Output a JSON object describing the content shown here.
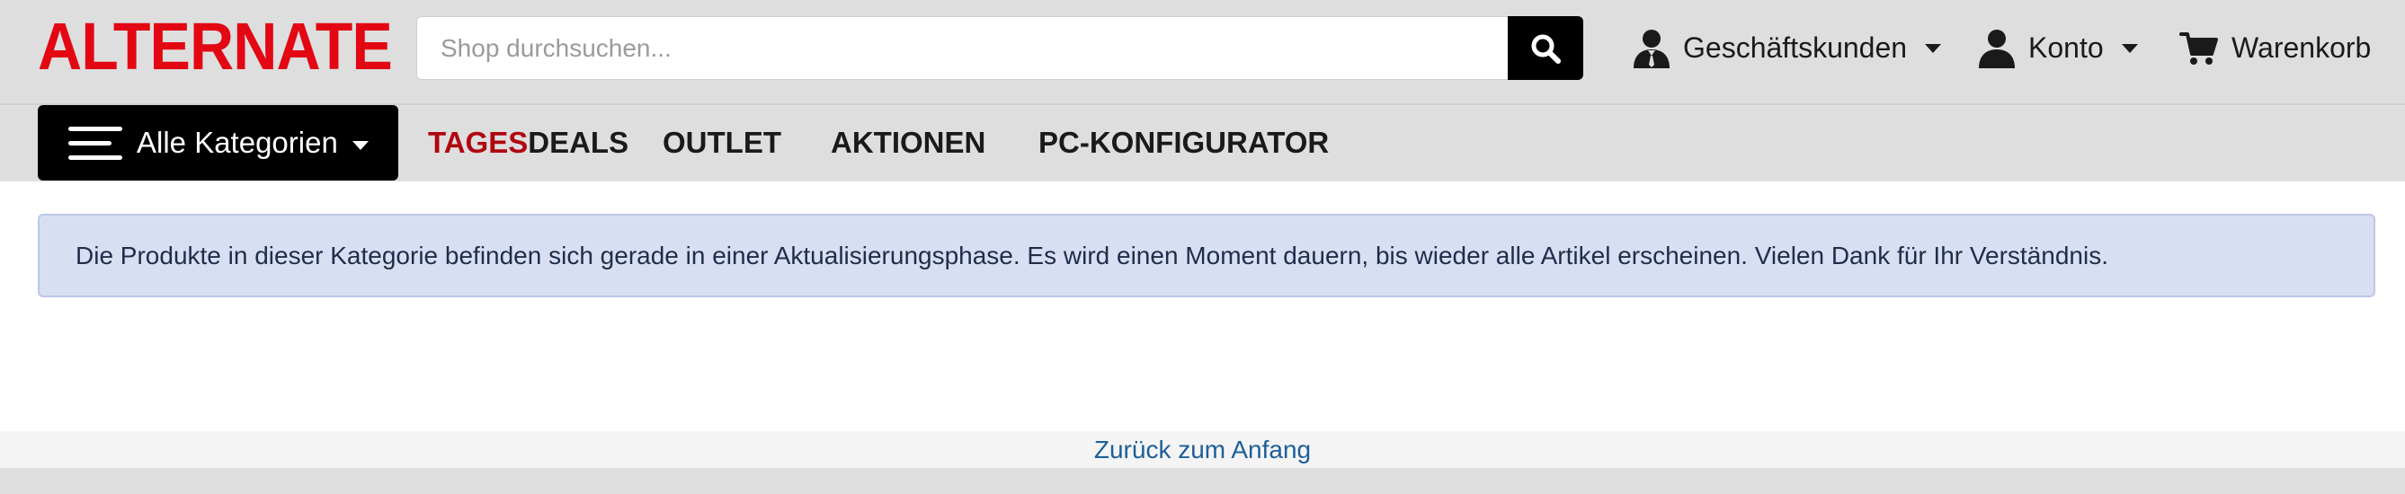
{
  "brand": {
    "logo_text": "ALTERNATE",
    "logo_color": "#e30613"
  },
  "header": {
    "search": {
      "placeholder": "Shop durchsuchen...",
      "value": ""
    },
    "business_label": "Geschäftskunden",
    "account_label": "Konto",
    "cart_label": "Warenkorb",
    "icons": [
      "search-icon",
      "business-person-icon",
      "person-icon",
      "cart-icon",
      "chevron-down-icon"
    ]
  },
  "nav": {
    "categories_label": "Alle Kategorien",
    "tagesdeals_prefix": "TAGES",
    "tagesdeals_suffix": "DEALS",
    "outlet_label": "OUTLET",
    "aktionen_label": "AKTIONEN",
    "pc_konfigurator_label": "PC-KONFIGURATOR",
    "accent_color": "#b00610"
  },
  "alert": {
    "message": "Die Produkte in dieser Kategorie befinden sich gerade in einer Aktualisierungsphase. Es wird einen Moment dauern, bis wieder alle Artikel erscheinen. Vielen Dank für Ihr Verständnis.",
    "background_color": "#d8dff2"
  },
  "footer": {
    "back_to_top_label": "Zurück zum Anfang",
    "link_color": "#1c5f99"
  }
}
